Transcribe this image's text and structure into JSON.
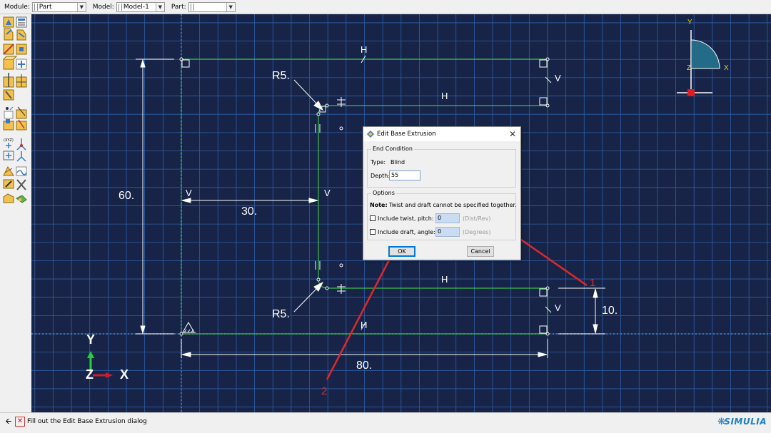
{
  "context_bar": {
    "module_label": "Module:",
    "module_value": "Part",
    "model_label": "Model:",
    "model_value": "Model-1",
    "part_label": "Part:",
    "part_value": ""
  },
  "sketch": {
    "dimensions": {
      "height": "60.",
      "inner_width": "30.",
      "width": "80.",
      "offset": "10.",
      "radius_top": "R5.",
      "radius_bottom": "R5."
    },
    "constraints": [
      "H",
      "H",
      "H",
      "H",
      "V",
      "V",
      "V",
      "V"
    ]
  },
  "triad": {
    "y": "Y",
    "z": "Z",
    "x": "X"
  },
  "view_triad": {
    "y": "Y",
    "z": "Z",
    "x": "X"
  },
  "callouts": {
    "one": "1",
    "two": "2"
  },
  "dialog": {
    "title": "Edit Base Extrusion",
    "end_condition_group": "End Condition",
    "type_label": "Type:",
    "type_value": "Blind",
    "depth_label": "Depth:",
    "depth_value": "55",
    "options_group": "Options",
    "note_label": "Note:",
    "note_text": "Twist and draft cannot be specified together.",
    "twist_label": "Include twist, pitch:",
    "twist_value": "0",
    "twist_unit": "(Dist/Rev)",
    "draft_label": "Include draft, angle:",
    "draft_value": "0",
    "draft_unit": "(Degrees)",
    "ok_label": "OK",
    "cancel_label": "Cancel"
  },
  "prompt": {
    "text": "Fill out the Edit Base Extrusion dialog",
    "brand": "SIMULIA"
  },
  "colors": {
    "viewport_bg": "#172447",
    "grid": "#2e5fa8",
    "sketch_line": "#35c14a",
    "callout_arrow": "#e0282a"
  }
}
